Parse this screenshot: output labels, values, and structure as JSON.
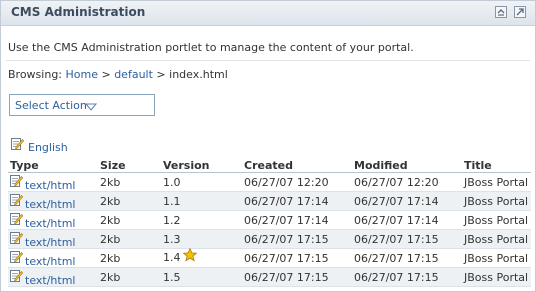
{
  "portlet": {
    "title": "CMS Administration"
  },
  "intro": "Use the CMS Administration portlet to manage the content of your portal.",
  "breadcrumb": {
    "prefix": "Browsing: ",
    "home": "Home",
    "sep1": " > ",
    "folder": "default",
    "sep2": " > ",
    "file": "index.html"
  },
  "action_select": {
    "label": "Select Action"
  },
  "language": "English",
  "table": {
    "headers": {
      "type": "Type",
      "size": "Size",
      "version": "Version",
      "created": "Created",
      "modified": "Modified",
      "title": "Title"
    },
    "rows": [
      {
        "type": "text/html",
        "size": "2kb",
        "version": "1.0",
        "created": "06/27/07 12:20",
        "modified": "06/27/07 12:20",
        "title": "JBoss Portal",
        "live": false
      },
      {
        "type": "text/html",
        "size": "2kb",
        "version": "1.1",
        "created": "06/27/07 17:14",
        "modified": "06/27/07 17:14",
        "title": "JBoss Portal",
        "live": false
      },
      {
        "type": "text/html",
        "size": "2kb",
        "version": "1.2",
        "created": "06/27/07 17:14",
        "modified": "06/27/07 17:14",
        "title": "JBoss Portal",
        "live": false
      },
      {
        "type": "text/html",
        "size": "2kb",
        "version": "1.3",
        "created": "06/27/07 17:15",
        "modified": "06/27/07 17:15",
        "title": "JBoss Portal",
        "live": false
      },
      {
        "type": "text/html",
        "size": "2kb",
        "version": "1.4",
        "created": "06/27/07 17:15",
        "modified": "06/27/07 17:15",
        "title": "JBoss Portal",
        "live": true
      },
      {
        "type": "text/html",
        "size": "2kb",
        "version": "1.5",
        "created": "06/27/07 17:15",
        "modified": "06/27/07 17:15",
        "title": "JBoss Portal",
        "live": false
      }
    ]
  },
  "icons": {
    "edit": "edit-document-icon",
    "star": "star-icon",
    "maximize": "maximize-icon",
    "restore": "restore-icon",
    "chevron": "chevron-down-icon"
  },
  "colors": {
    "link": "#2b5f9e",
    "title": "#3c4c5f",
    "star": "#f2c200"
  }
}
